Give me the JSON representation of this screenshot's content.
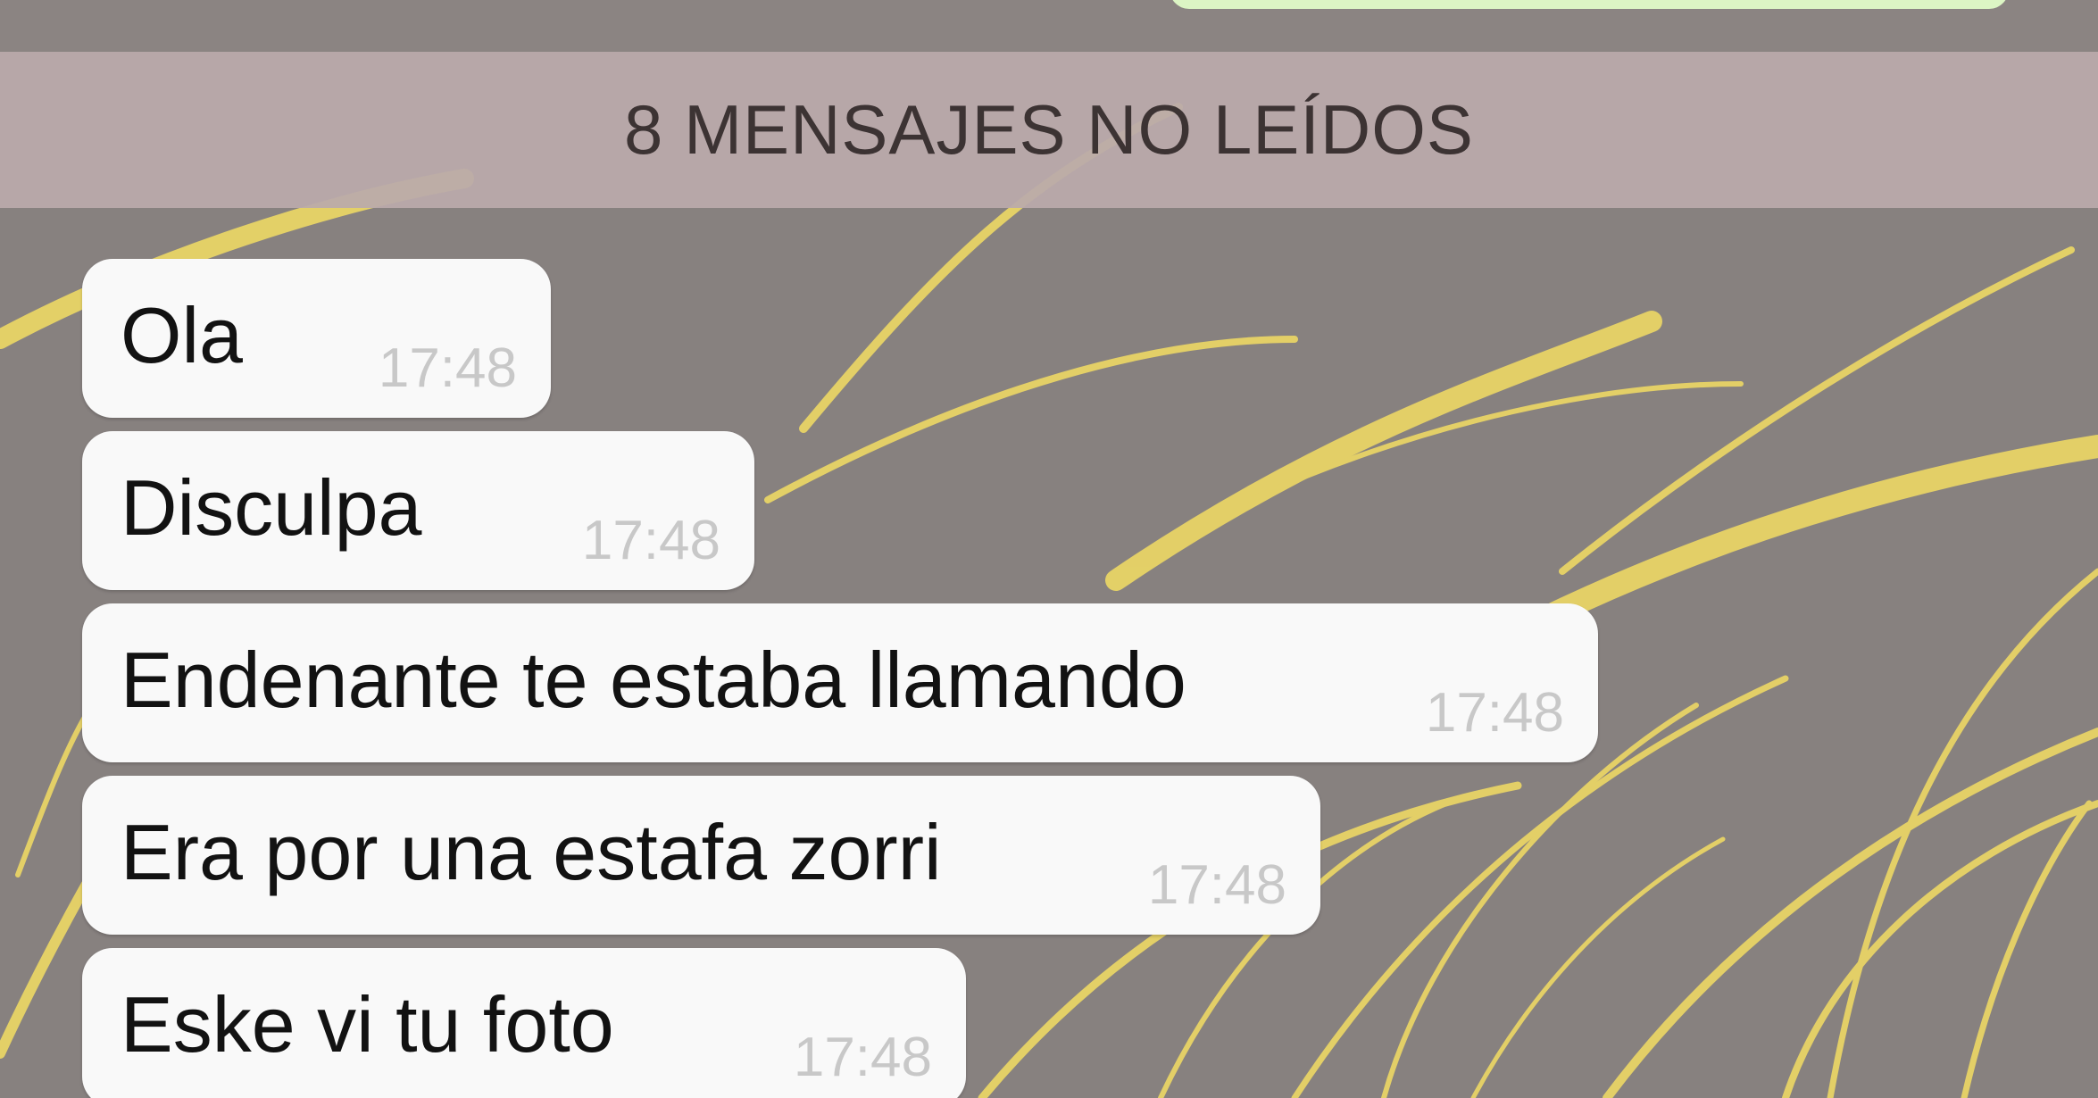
{
  "unread_banner": {
    "text": "8 MENSAJES NO LEÍDOS"
  },
  "messages": [
    {
      "text": "Ola",
      "time": "17:48"
    },
    {
      "text": "Disculpa",
      "time": "17:48"
    },
    {
      "text": "Endenante te estaba llamando",
      "time": "17:48"
    },
    {
      "text": "Era por una estafa zorri",
      "time": "17:48"
    },
    {
      "text": "Eske vi tu foto",
      "time": "17:48"
    }
  ],
  "colors": {
    "wallpaper_background": "#87817f",
    "wallpaper_grass": "#e8d466",
    "banner_background": "#baaaab",
    "incoming_bubble": "#f9f9f9",
    "outgoing_bubble": "#dcf5c4",
    "timestamp": "#c8c8c8"
  }
}
